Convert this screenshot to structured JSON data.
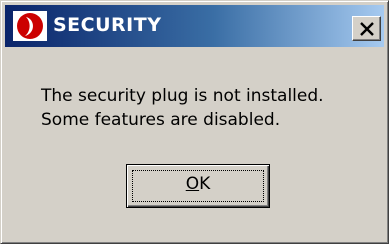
{
  "window": {
    "title": "SECURITY",
    "icon": "app-logo-icon",
    "close_icon": "close-icon",
    "colors": {
      "title_gradient_start": "#0a246a",
      "title_gradient_end": "#a6caf0",
      "logo_red": "#cc0000",
      "face": "#d4d0c8"
    }
  },
  "message": {
    "line1": "The security plug is not installed.",
    "line2": "Some features are disabled."
  },
  "ok_button": {
    "mnemonic": "O",
    "rest": "K"
  }
}
